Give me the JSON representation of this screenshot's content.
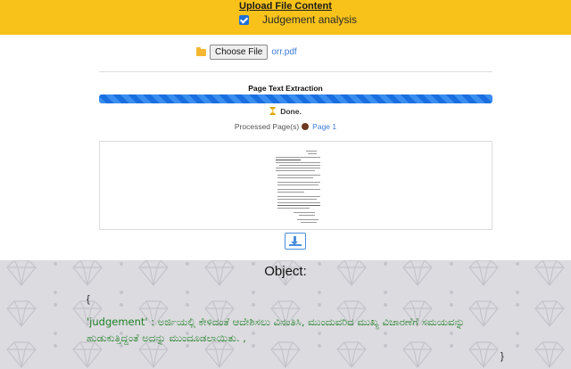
{
  "header": {
    "title": "Upload File Content",
    "checkbox_label": "Judgement analysis",
    "checkbox_checked": true,
    "accent_color": "#f8c21a"
  },
  "file_input": {
    "button_label": "Choose File",
    "file_name": "orr.pdf"
  },
  "extraction": {
    "title": "Page Text Extraction",
    "progress": 1.0,
    "status": "Done.",
    "processed_label": "Processed Page(s)",
    "page_link": "Page 1"
  },
  "icons": [
    "folder-icon",
    "hourglass-icon",
    "download-icon",
    "checkbox-check-icon",
    "diamond-pattern"
  ],
  "object": {
    "title": "Object:",
    "open_brace": "{",
    "content": "'judgement' : ಅರ್ಜಿಯಲ್ಲಿ ಕೇಳಿದಂತೆ ಆದೇಶಿಸಲು ವಿನಂತಿಸಿ, ಮುಂದುವರಿದ ಮುಖ್ಯ ವಿಚಾರಣೆಗೆ ಸಮಯವನ್ನು ಹುಡುಕುತ್ತಿದ್ದಂತೆ ಅದನ್ನು ಮುಂದೂಡಲಾಯಿತು. ,",
    "close_brace": "}",
    "text_color": "#1d7f23"
  }
}
